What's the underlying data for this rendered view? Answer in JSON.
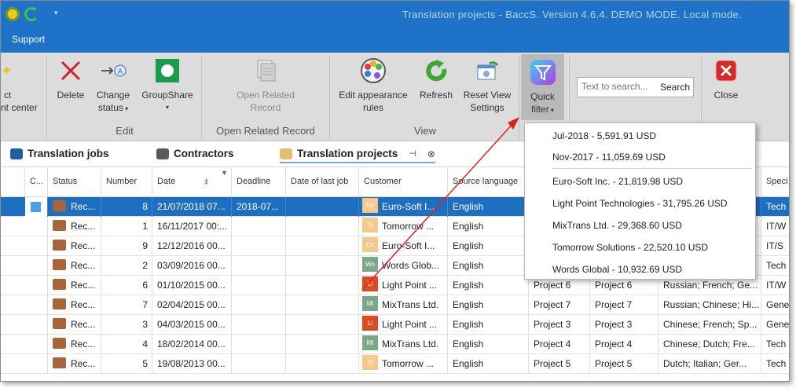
{
  "window": {
    "title": "Translation projects - BaccS. Version 4.6.4. DEMO MODE. Local mode."
  },
  "menu": {
    "support": "Support"
  },
  "ribbon": {
    "partial_label_1": "ct",
    "partial_label_2": "nt center",
    "delete": "Delete",
    "change_status_1": "Change",
    "change_status_2": "status",
    "groupshare": "GroupShare",
    "edit_group": "Edit",
    "open_related_1": "Open Related",
    "open_related_2": "Record",
    "open_related_group": "Open Related Record",
    "edit_appearance_1": "Edit appearance",
    "edit_appearance_2": "rules",
    "refresh": "Refresh",
    "reset_view_1": "Reset View",
    "reset_view_2": "Settings",
    "view_group": "View",
    "quick_filter_1": "Quick",
    "quick_filter_2": "filter",
    "search_placeholder": "Text to search...",
    "search_button": "Search",
    "close": "Close"
  },
  "tabs": [
    {
      "label": "Translation jobs"
    },
    {
      "label": "Contractors"
    },
    {
      "label": "Translation projects"
    }
  ],
  "grid": {
    "headers": [
      "C...",
      "Status",
      "Number",
      "Date",
      "Deadline",
      "Date of last job",
      "Customer",
      "Source language",
      "",
      "",
      "",
      "Speci"
    ],
    "rows": [
      {
        "status": "Rec...",
        "number": "8",
        "date": "21/07/2018 07...",
        "deadline": "2018-07...",
        "customer": "Euro-Soft I...",
        "avatar": "Eu",
        "src": "English",
        "p1": "",
        "p2": "",
        "langs": "",
        "spec": "Tech"
      },
      {
        "status": "Rec...",
        "number": "1",
        "date": "16/11/2017 00:...",
        "deadline": "",
        "customer": "Tomorrow ...",
        "avatar": "To",
        "src": "English",
        "p1": "",
        "p2": "",
        "langs": "",
        "spec": "IT/W"
      },
      {
        "status": "Rec...",
        "number": "9",
        "date": "12/12/2016 00...",
        "deadline": "",
        "customer": "Euro-Soft I...",
        "avatar": "Eu",
        "src": "English",
        "p1": "",
        "p2": "",
        "langs": "",
        "spec": "IT/S"
      },
      {
        "status": "Rec...",
        "number": "2",
        "date": "03/09/2016 00...",
        "deadline": "",
        "customer": "Words Glob...",
        "avatar": "Wo",
        "src": "English",
        "p1": "",
        "p2": "",
        "langs": "",
        "spec": "Tech"
      },
      {
        "status": "Rec...",
        "number": "6",
        "date": "01/10/2015 00...",
        "deadline": "",
        "customer": "Light Point ...",
        "avatar": "Li",
        "src": "English",
        "p1": "Project 6",
        "p2": "Project 6",
        "langs": "Russian; French; Ge...",
        "spec": "IT/W"
      },
      {
        "status": "Rec...",
        "number": "7",
        "date": "02/04/2015 00...",
        "deadline": "",
        "customer": "MixTrans Ltd.",
        "avatar": "Mi",
        "src": "English",
        "p1": "Project 7",
        "p2": "Project 7",
        "langs": "Russian; Chinese; Hi...",
        "spec": "Gene"
      },
      {
        "status": "Rec...",
        "number": "3",
        "date": "04/03/2015 00...",
        "deadline": "",
        "customer": "Light Point ...",
        "avatar": "Li",
        "src": "English",
        "p1": "Project 3",
        "p2": "Project 3",
        "langs": "Chinese; French; Sp...",
        "spec": "Gene"
      },
      {
        "status": "Rec...",
        "number": "4",
        "date": "18/02/2014 00...",
        "deadline": "",
        "customer": "MixTrans Ltd.",
        "avatar": "Mi",
        "src": "English",
        "p1": "Project 4",
        "p2": "Project 4",
        "langs": "Chinese; Dutch; Fre...",
        "spec": "Tech"
      },
      {
        "status": "Rec...",
        "number": "5",
        "date": "19/08/2013 00...",
        "deadline": "",
        "customer": "Tomorrow ...",
        "avatar": "To",
        "src": "English",
        "p1": "Project 5",
        "p2": "Project 5",
        "langs": "Dutch; Italian; Ger...",
        "spec": "Tech"
      }
    ]
  },
  "quick_filter": {
    "group1": [
      "Jul-2018 - 5,591.91 USD",
      "Nov-2017 - 11,059.69 USD"
    ],
    "group2": [
      "Euro-Soft Inc. - 21,819.98 USD",
      "Light Point Technologies - 31,795.26 USD",
      "MixTrans Ltd. - 29,368.60 USD",
      "Tomorrow Solutions - 22,520.10 USD",
      "Words Global - 10,932.69 USD"
    ]
  },
  "colors": {
    "accent": "#1e73c8",
    "selection": "#1d6fc2",
    "annotation_arrow": "#e02020"
  }
}
